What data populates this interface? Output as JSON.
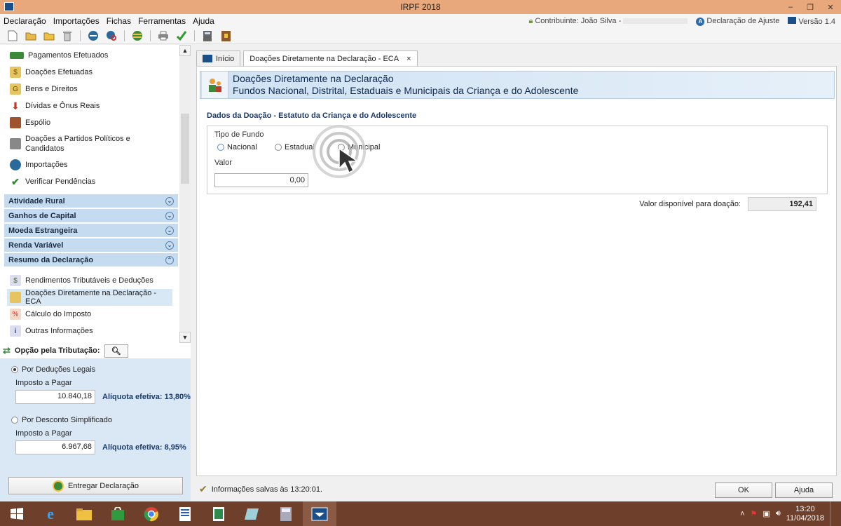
{
  "window": {
    "title": "IRPF 2018",
    "minimize": "–",
    "restore": "❐",
    "close": "✕"
  },
  "menu": [
    "Declaração",
    "Importações",
    "Fichas",
    "Ferramentas",
    "Ajuda"
  ],
  "menu_right": {
    "contribuinte": "Contribuinte: João Silva -",
    "declaracao": "Declaração de Ajuste",
    "versao": "Versão 1.4"
  },
  "toolbar_icons": [
    "new-file-icon",
    "open-folder-icon",
    "folder-icon",
    "trash-icon",
    "import-icon",
    "search-import-icon",
    "globe-icon",
    "print-icon",
    "check-icon",
    "calculator-icon",
    "book-icon"
  ],
  "sidebar": {
    "items": [
      {
        "label": "Pagamentos Efetuados",
        "icon": "payment-icon",
        "color": "#3a8a3a"
      },
      {
        "label": "Doações Efetuadas",
        "icon": "donation-icon",
        "color": "#c9a23a"
      },
      {
        "label": "Bens e Direitos",
        "icon": "assets-icon",
        "color": "#c9a23a"
      },
      {
        "label": "Dívidas e Ônus Reais",
        "icon": "debt-arrow-icon",
        "color": "#c0392b"
      },
      {
        "label": "Espólio",
        "icon": "estate-icon",
        "color": "#a0522d"
      },
      {
        "label": "Doações a Partidos Políticos e Candidatos",
        "icon": "party-donation-icon",
        "color": "#555"
      },
      {
        "label": "Importações",
        "icon": "import-icon",
        "color": "#2a6a9a"
      },
      {
        "label": "Verificar Pendências",
        "icon": "check-icon",
        "color": "#2e8b2e"
      }
    ],
    "sections": [
      {
        "label": "Atividade Rural",
        "state": "collapsed"
      },
      {
        "label": "Ganhos de Capital",
        "state": "collapsed"
      },
      {
        "label": "Moeda Estrangeira",
        "state": "collapsed"
      },
      {
        "label": "Renda Variável",
        "state": "collapsed"
      },
      {
        "label": "Resumo da Declaração",
        "state": "expanded"
      }
    ],
    "summary_items": [
      {
        "label": "Rendimentos Tributáveis e Deduções",
        "icon": "income-icon"
      },
      {
        "label": "Doações Diretamente na Declaração - ECA",
        "icon": "eca-icon",
        "selected": true
      },
      {
        "label": "Cálculo do Imposto",
        "icon": "tax-calc-icon"
      },
      {
        "label": "Outras Informações",
        "icon": "info-icon"
      }
    ],
    "chev_down": "⌄",
    "chev_up": "⌃"
  },
  "tax_panel": {
    "title": "Opção pela Tributação:",
    "option1": {
      "label": "Por Deduções Legais",
      "selected": true,
      "imposto_label": "Imposto a Pagar",
      "imposto_value": "10.840,18",
      "aliquota": "Alíquota efetiva: 13,80%"
    },
    "option2": {
      "label": "Por Desconto Simplificado",
      "selected": false,
      "imposto_label": "Imposto a Pagar",
      "imposto_value": "6.967,68",
      "aliquota": "Alíquota efetiva: 8,95%"
    },
    "entregar": "Entregar Declaração"
  },
  "tabs": [
    {
      "label": "Início"
    },
    {
      "label": "Doações Diretamente na Declaração - ECA",
      "close": "×"
    }
  ],
  "form": {
    "header_line1": "Doações Diretamente na Declaração",
    "header_line2": "Fundos Nacional, Distrital, Estaduais e Municipais da Criança e do Adolescente",
    "section_title": "Dados da Doação - Estatuto da Criança e do Adolescente",
    "tipo_label": "Tipo de Fundo",
    "radios": [
      "Nacional",
      "Estadual",
      "Municipal"
    ],
    "valor_label": "Valor",
    "valor": "0,00",
    "disponivel_label": "Valor disponível para doação:",
    "disponivel_value": "192,41"
  },
  "status": {
    "message": "Informações salvas às 13:20:01."
  },
  "buttons": {
    "ok": "OK",
    "ajuda": "Ajuda"
  },
  "taskbar": {
    "apps": [
      "start-icon",
      "ie-icon",
      "explorer-icon",
      "store-icon",
      "chrome-icon",
      "word-icon",
      "excel-icon",
      "app-icon",
      "calculator-icon",
      "irpf-icon"
    ],
    "time": "13:20",
    "date": "11/04/2018"
  },
  "colors": {
    "titlebar": "#e8a87c",
    "taskbar": "#6e3f2a",
    "section_header": "#c5dcf0",
    "tax_panel": "#dae8f6"
  }
}
